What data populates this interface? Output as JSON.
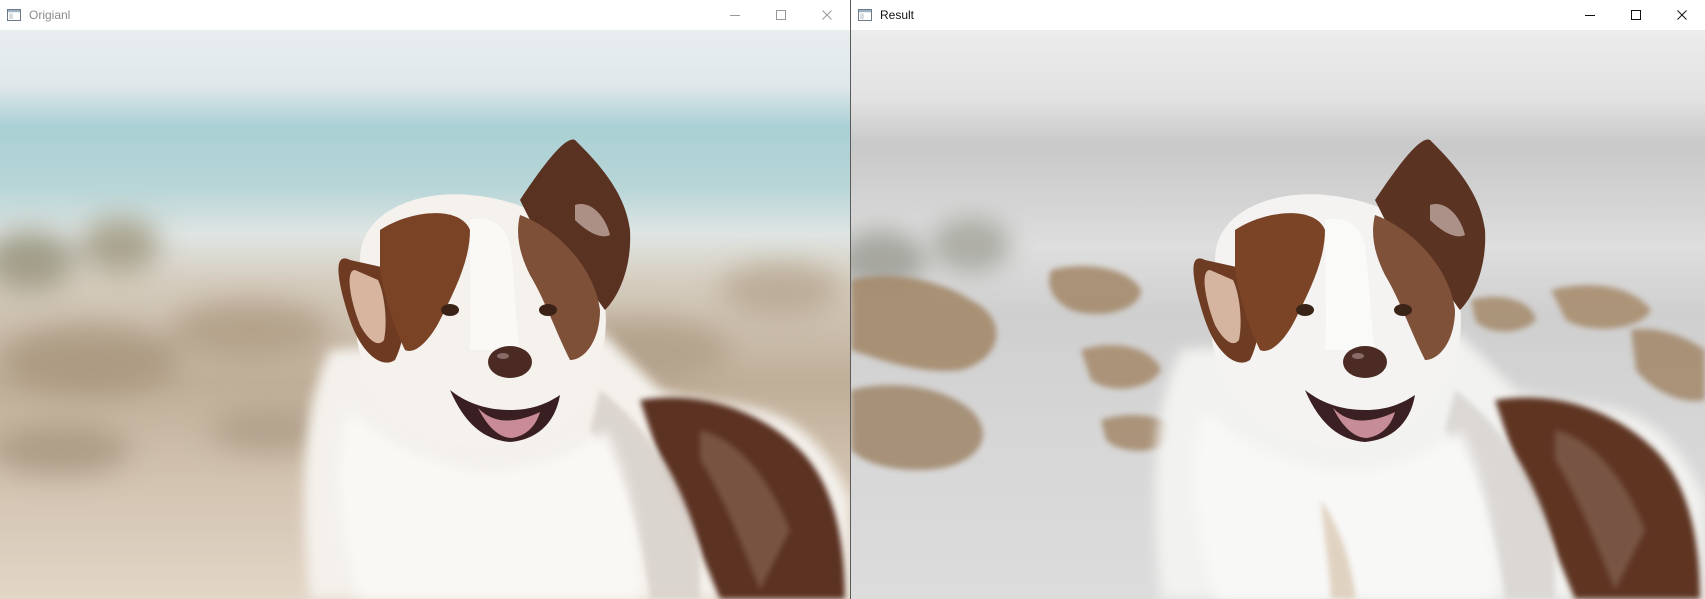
{
  "windows": {
    "left": {
      "title": "Origianl",
      "image": "dog-photo-original",
      "controls": [
        "minimize-icon",
        "maximize-icon",
        "close-icon"
      ],
      "title_color": "#8a8a8a"
    },
    "right": {
      "title": "Result",
      "image": "dog-photo-result",
      "controls": [
        "minimize-icon",
        "maximize-icon",
        "close-icon"
      ],
      "title_color": "#111111"
    }
  },
  "colors": {
    "titlebar_bg": "#ffffff",
    "divider": "#5a5a5a",
    "dog_brown": "#6b3a22",
    "dog_white": "#f6f3ef",
    "sky": "#e6ecef",
    "sea": "#a8cfd3",
    "sand": "#cdbba7",
    "gray_bg": "#d8d8d8"
  }
}
